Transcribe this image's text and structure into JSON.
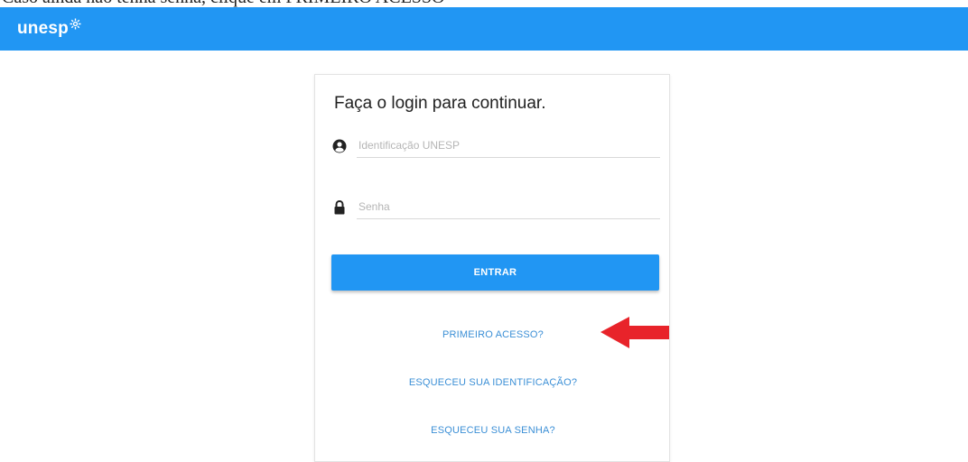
{
  "document_fragment": "Caso ainda não tenha senha, clique em PRIMEIRO ACESSO",
  "header": {
    "logo_text": "unesp",
    "brand_color": "#2196f3"
  },
  "login": {
    "title": "Faça o login para continuar.",
    "username_placeholder": "Identificação UNESP",
    "password_placeholder": "Senha",
    "submit_label": "ENTRAR",
    "link_first_access": "PRIMEIRO ACESSO?",
    "link_forgot_id": "ESQUECEU SUA IDENTIFICAÇÃO?",
    "link_forgot_password": "ESQUECEU SUA SENHA?"
  },
  "icons": {
    "username": "user-circle-icon",
    "password": "lock-icon",
    "annotation": "red-arrow-icon"
  },
  "annotation_color": "#e8232a"
}
